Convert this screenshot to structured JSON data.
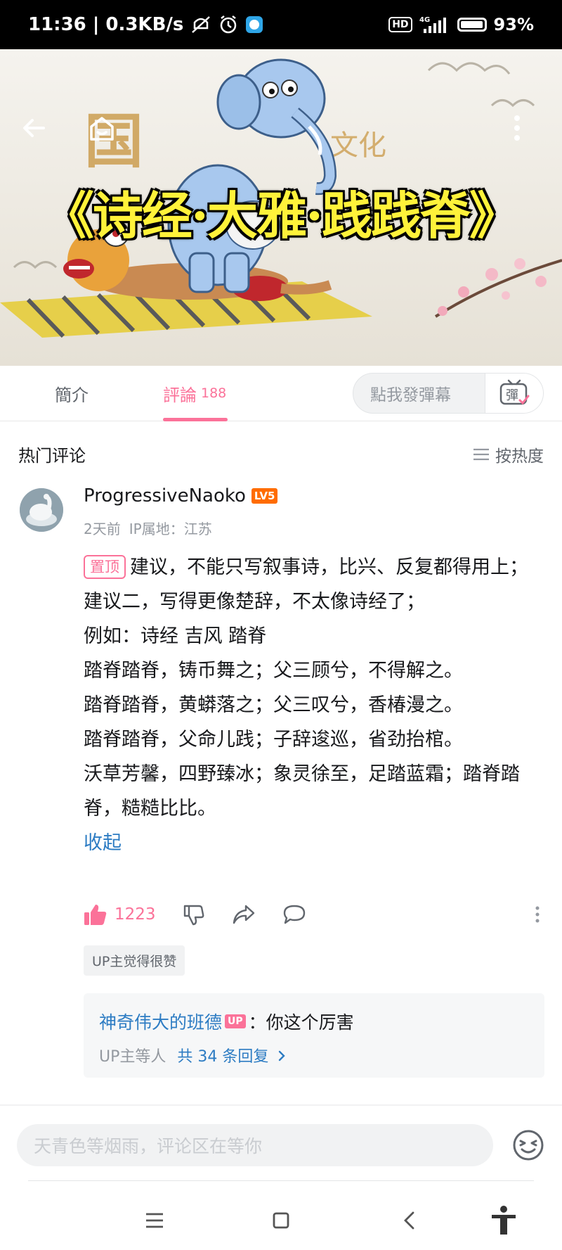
{
  "status_bar": {
    "time_speed": "11:36 | 0.3KB/s",
    "network": "4G",
    "hd": "HD",
    "battery": "93%"
  },
  "video": {
    "title_text": "《诗经·大雅·践践脊》"
  },
  "tabs": {
    "intro": "簡介",
    "comments": "評論",
    "comments_count": "188",
    "danmaku_placeholder": "點我發彈幕",
    "danmaku_button": "彈"
  },
  "comments_section": {
    "title": "热门评论",
    "sort_label": "按热度"
  },
  "comment": {
    "username": "ProgressiveNaoko",
    "level": "LV5",
    "time": "2天前",
    "ip": "IP属地：江苏",
    "pinned_label": "置顶",
    "lines": [
      "建议，不能只写叙事诗，比兴、反复都得用上；",
      "建议二，写得更像楚辞，不太像诗经了；",
      "例如：诗经 吉风 踏脊",
      "踏脊踏脊，铸币舞之；父三顾兮，不得解之。",
      "踏脊踏脊，黄蟒落之；父三叹兮，香椿漫之。",
      "踏脊踏脊，父命儿践；子辞逡巡，省劲抬棺。",
      "沃草芳馨，四野臻冰；象灵徐至，足踏蓝霜；踏脊踏脊，糙糙比比。"
    ],
    "collapse_label": "收起",
    "like_count": "1223",
    "up_liked_tag": "UP主觉得很赞",
    "reply": {
      "user": "神奇伟大的班德",
      "badge": "UP",
      "text": "：你这个厉害",
      "meta_prefix": "UP主等人",
      "count_text": "共 34 条回复"
    }
  },
  "input": {
    "placeholder": "天青色等烟雨，评论区在等你"
  },
  "colors": {
    "accent_pink": "#fb7299",
    "link_blue": "#2d7cc3",
    "level_orange": "#ff6c00"
  }
}
